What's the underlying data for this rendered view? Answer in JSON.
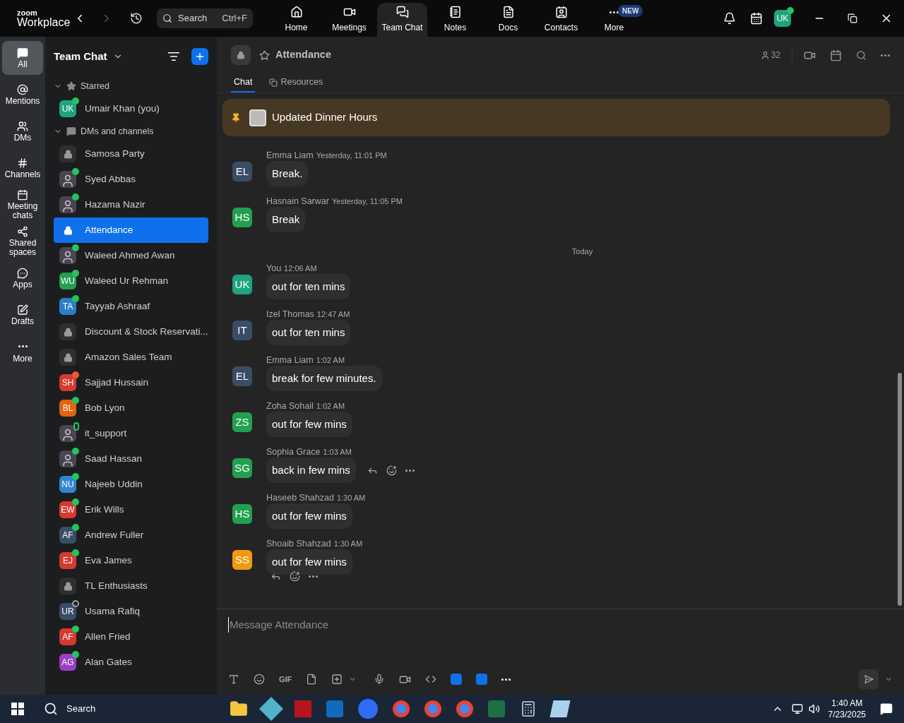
{
  "app": {
    "logo_top": "zoom",
    "logo_bottom": "Workplace",
    "search": {
      "placeholder": "Search",
      "shortcut": "Ctrl+F"
    }
  },
  "nav_tabs": [
    {
      "label": "Home",
      "selected": false
    },
    {
      "label": "Meetings",
      "selected": false
    },
    {
      "label": "Team Chat",
      "selected": true
    },
    {
      "label": "Notes",
      "selected": false
    },
    {
      "label": "Docs",
      "selected": false
    },
    {
      "label": "Contacts",
      "selected": false
    },
    {
      "label": "More",
      "selected": false,
      "badge": "NEW"
    }
  ],
  "profile": {
    "initials": "UK",
    "status": {
      "kind": "dot",
      "color": "#22c55e"
    }
  },
  "rail": [
    {
      "label": "All",
      "selected": true
    },
    {
      "label": "Mentions",
      "selected": false
    },
    {
      "label": "DMs",
      "selected": false
    },
    {
      "label": "Channels",
      "selected": false
    },
    {
      "label": "Meeting chats",
      "selected": false
    },
    {
      "label": "Shared spaces",
      "selected": false
    },
    {
      "label": "Apps",
      "selected": false
    },
    {
      "label": "Drafts",
      "selected": false
    },
    {
      "label": "More",
      "selected": false
    }
  ],
  "sidebar": {
    "title": "Team Chat",
    "sections": [
      {
        "label": "Starred",
        "expanded": true,
        "items": [
          {
            "name": "Umair Khan (you)",
            "kind": "initials",
            "initials": "UK",
            "color": "#1fa37f",
            "status": {
              "kind": "dot",
              "color": "#22c55e"
            },
            "selected": false
          }
        ]
      },
      {
        "label": "DMs and channels",
        "expanded": true,
        "items": [
          {
            "name": "Samosa Party",
            "kind": "lock",
            "selected": false
          },
          {
            "name": "Syed Abbas",
            "kind": "photo",
            "status": {
              "kind": "dot",
              "color": "#22c55e"
            },
            "selected": false
          },
          {
            "name": "Hazama Nazir",
            "kind": "photo",
            "status": {
              "kind": "dot",
              "color": "#22c55e"
            },
            "selected": false
          },
          {
            "name": "Attendance",
            "kind": "lock",
            "selected": true
          },
          {
            "name": "Waleed Ahmed Awan",
            "kind": "photo",
            "status": {
              "kind": "dot",
              "color": "#22c55e"
            },
            "selected": false
          },
          {
            "name": "Waleed Ur Rehman",
            "kind": "initials",
            "initials": "WU",
            "color": "#22a04f",
            "status": {
              "kind": "dot",
              "color": "#22c55e"
            },
            "selected": false
          },
          {
            "name": "Tayyab Ashraaf",
            "kind": "initials",
            "initials": "TA",
            "color": "#2d7fc4",
            "status": {
              "kind": "dot",
              "color": "#22c55e"
            },
            "selected": false
          },
          {
            "name": "Discount & Stock Reservati...",
            "kind": "lock",
            "selected": false
          },
          {
            "name": "Amazon Sales Team",
            "kind": "lock",
            "selected": false
          },
          {
            "name": "Sajjad Hussain",
            "kind": "initials",
            "initials": "SH",
            "color": "#d63a2f",
            "status": {
              "kind": "dot",
              "color": "#f0562d"
            },
            "selected": false
          },
          {
            "name": "Bob Lyon",
            "kind": "initials",
            "initials": "BL",
            "color": "#e2640f",
            "status": {
              "kind": "dot",
              "color": "#22c55e"
            },
            "selected": false
          },
          {
            "name": "it_support",
            "kind": "photo",
            "status": {
              "kind": "phone",
              "color": "#22c55e"
            },
            "selected": false
          },
          {
            "name": "Saad Hassan",
            "kind": "photo",
            "status": {
              "kind": "dot",
              "color": "#22c55e"
            },
            "selected": false
          },
          {
            "name": "Najeeb Uddin",
            "kind": "initials",
            "initials": "NU",
            "color": "#2f86cf",
            "status": {
              "kind": "dot",
              "color": "#22c55e"
            },
            "selected": false
          },
          {
            "name": "Erik Wills",
            "kind": "initials",
            "initials": "EW",
            "color": "#d63a2f",
            "status": {
              "kind": "dot",
              "color": "#22c55e"
            },
            "selected": false
          },
          {
            "name": "Andrew Fuller",
            "kind": "initials",
            "initials": "AF",
            "color": "#3a4d66",
            "status": {
              "kind": "dot",
              "color": "#22c55e"
            },
            "selected": false
          },
          {
            "name": "Eva James",
            "kind": "initials",
            "initials": "EJ",
            "color": "#d63a2f",
            "status": {
              "kind": "dot",
              "color": "#22c55e"
            },
            "selected": false
          },
          {
            "name": "TL Enthusiasts",
            "kind": "lock",
            "selected": false
          },
          {
            "name": "Usama Rafiq",
            "kind": "initials",
            "initials": "UR",
            "color": "#3a4d66",
            "status": {
              "kind": "ring",
              "color": "#9aa0a6"
            },
            "selected": false
          },
          {
            "name": "Allen Fried",
            "kind": "initials",
            "initials": "AF",
            "color": "#d63a2f",
            "status": {
              "kind": "dot",
              "color": "#22c55e"
            },
            "selected": false
          },
          {
            "name": "Alan Gates",
            "kind": "initials",
            "initials": "AG",
            "color": "#9b3fc2",
            "status": {
              "kind": "dot",
              "color": "#22c55e"
            },
            "selected": false
          }
        ]
      }
    ]
  },
  "channel": {
    "title": "Attendance",
    "members": "32",
    "tabs": [
      {
        "label": "Chat",
        "selected": true
      },
      {
        "label": "Resources",
        "selected": false
      }
    ],
    "pinned": "Updated Dinner Hours",
    "messages": [
      {
        "kind": "message",
        "sender": "Emma Liam",
        "time": "Yesterday, 11:01 PM",
        "initials": "EL",
        "color": "#3a4d66",
        "text": "Break.",
        "hovered": false
      },
      {
        "kind": "message",
        "sender": "Hasnain Sarwar",
        "time": "Yesterday, 11:05 PM",
        "initials": "HS",
        "color": "#22a04f",
        "text": "Break",
        "hovered": false
      },
      {
        "kind": "divider",
        "text": "Today"
      },
      {
        "kind": "message",
        "sender": "You",
        "time": "12:06 AM",
        "initials": "UK",
        "color": "#1fa37f",
        "text": "out for ten mins",
        "hovered": false
      },
      {
        "kind": "message",
        "sender": "Izel Thomas",
        "time": "12:47 AM",
        "initials": "IT",
        "color": "#3a4d66",
        "text": "out for ten mins",
        "hovered": false
      },
      {
        "kind": "message",
        "sender": "Emma Liam",
        "time": "1:02 AM",
        "initials": "EL",
        "color": "#3a4d66",
        "text": "break for few minutes.",
        "hovered": false
      },
      {
        "kind": "message",
        "sender": "Zoha Sohail",
        "time": "1:02 AM",
        "initials": "ZS",
        "color": "#22a04f",
        "text": "out for few mins",
        "hovered": false
      },
      {
        "kind": "message",
        "sender": "Sophia Grace",
        "time": "1:03 AM",
        "initials": "SG",
        "color": "#22a04f",
        "text": "back in few mins",
        "hovered": true
      },
      {
        "kind": "message",
        "sender": "Haseeb Shahzad",
        "time": "1:30 AM",
        "initials": "HS",
        "color": "#22a04f",
        "text": "out for few mins",
        "hovered": false
      },
      {
        "kind": "message",
        "sender": "Shoaib Shahzad",
        "time": "1:30 AM",
        "initials": "SS",
        "color": "#f29a0e",
        "text": "out for few mins",
        "hovered": false
      },
      {
        "kind": "toolbar"
      }
    ],
    "composer": {
      "placeholder": "Message Attendance",
      "gif": "GIF"
    }
  },
  "taskbar": {
    "search": "Search",
    "time": "1:40 AM",
    "date": "7/23/2025"
  }
}
